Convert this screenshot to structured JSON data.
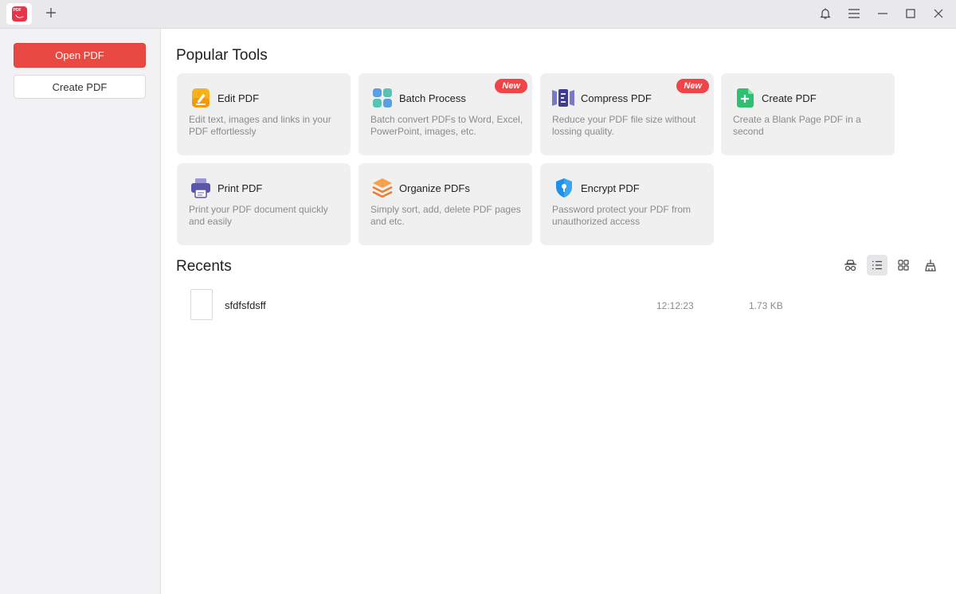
{
  "titlebar": {
    "logo_text": "PDF",
    "icons": [
      "plus-icon",
      "bell-icon",
      "menu-icon",
      "minimize-icon",
      "maximize-icon",
      "close-icon"
    ]
  },
  "sidebar": {
    "open_label": "Open PDF",
    "create_label": "Create PDF",
    "accent_color": "#e84a43"
  },
  "main": {
    "popular_title": "Popular Tools",
    "recents_title": "Recents",
    "tools": [
      {
        "name": "Edit PDF",
        "desc": "Edit text, images and links in your PDF effortlessly",
        "icon": "edit-pdf-icon",
        "badge": ""
      },
      {
        "name": "Batch Process",
        "desc": "Batch convert PDFs to Word, Excel, PowerPoint, images, etc.",
        "icon": "batch-process-icon",
        "badge": "New"
      },
      {
        "name": "Compress PDF",
        "desc": "Reduce your PDF file size without lossing quality.",
        "icon": "compress-pdf-icon",
        "badge": "New"
      },
      {
        "name": "Create PDF",
        "desc": "Create a Blank Page PDF in a second",
        "icon": "create-pdf-icon",
        "badge": ""
      },
      {
        "name": "Print PDF",
        "desc": "Print your PDF document quickly and easily",
        "icon": "printer-icon",
        "badge": ""
      },
      {
        "name": "Organize PDFs",
        "desc": "Simply sort, add, delete PDF pages and etc.",
        "icon": "layers-icon",
        "badge": ""
      },
      {
        "name": "Encrypt PDF",
        "desc": "Password protect your PDF from unauthorized access",
        "icon": "shield-lock-icon",
        "badge": ""
      }
    ],
    "view_icons": [
      "incognito-icon",
      "list-view-icon",
      "grid-view-icon",
      "clean-icon"
    ],
    "active_view": "list-view-icon",
    "recents": [
      {
        "name": "sfdfsfdsff",
        "time": "12:12:23",
        "size": "1.73 KB"
      }
    ]
  }
}
